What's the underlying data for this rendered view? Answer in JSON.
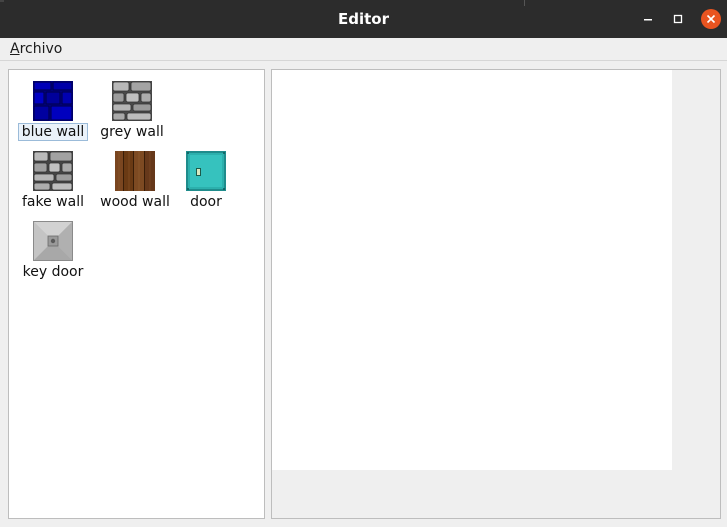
{
  "window": {
    "title": "Editor"
  },
  "menubar": {
    "archivo_mnemonic": "A",
    "archivo_rest": "rchivo"
  },
  "palette": {
    "items": [
      {
        "label": "blue wall",
        "icon": "blue-wall-tile-icon",
        "selected": true
      },
      {
        "label": "grey wall",
        "icon": "grey-wall-tile-icon",
        "selected": false
      },
      {
        "label": "fake wall",
        "icon": "fake-wall-tile-icon",
        "selected": false
      },
      {
        "label": "wood wall",
        "icon": "wood-wall-tile-icon",
        "selected": false
      },
      {
        "label": "door",
        "icon": "door-tile-icon",
        "selected": false
      },
      {
        "label": "key door",
        "icon": "key-door-tile-icon",
        "selected": false
      }
    ]
  },
  "colors": {
    "titlebar": "#2c2c2c",
    "close_button": "#e95420",
    "selection": "#eaf2fa"
  }
}
